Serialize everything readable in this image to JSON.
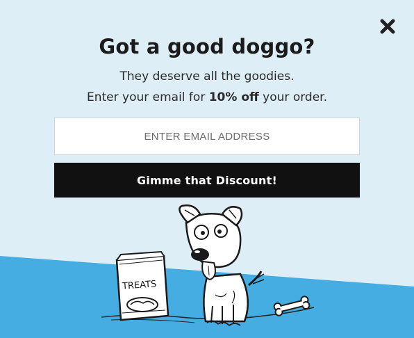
{
  "colors": {
    "background": "#ddeef7",
    "band": "#45ade1",
    "button": "#111111",
    "button_text": "#ffffff"
  },
  "close": {
    "icon": "close-icon"
  },
  "headline": "Got a good doggo?",
  "subline": "They deserve all the goodies.",
  "offer": {
    "prefix": "Enter your email for ",
    "highlight": "10% off",
    "suffix": " your order."
  },
  "email": {
    "placeholder": "ENTER EMAIL ADDRESS",
    "value": ""
  },
  "submit_label": "Gimme that Discount!",
  "illustration": {
    "treats_label": "TREATS",
    "icons": [
      "dog-illustration",
      "treats-bag-icon",
      "bone-icon"
    ]
  }
}
